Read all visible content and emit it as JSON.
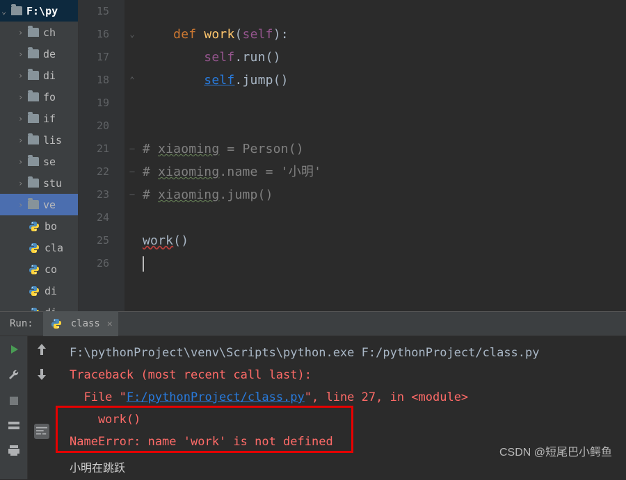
{
  "sidebar": {
    "root": "F:\\py",
    "items": [
      "ch",
      "de",
      "di",
      "fo",
      "if",
      "lis",
      "se",
      "stu",
      "ve",
      "bo",
      "cla",
      "co",
      "di",
      "di"
    ]
  },
  "gutter": {
    "start": 15,
    "end": 26
  },
  "fold_marks": [
    {
      "line": 16,
      "glyph": "⌄"
    },
    {
      "line": 18,
      "glyph": "⌃"
    },
    {
      "line": 21,
      "glyph": "–"
    },
    {
      "line": 22,
      "glyph": "–"
    },
    {
      "line": 23,
      "glyph": "–"
    }
  ],
  "code": {
    "def": "def",
    "work": "work",
    "self_param": "self",
    "colon": ":",
    "self1": "self",
    "run": ".run()",
    "self2": "self",
    "jump": ".jump()",
    "cmt1_hash": "# ",
    "cmt1_name": "xiaoming",
    "cmt1_rest": " = Person()",
    "cmt2_hash": "# ",
    "cmt2_name": "xiaoming",
    "cmt2_rest": ".name = '小明'",
    "cmt3_hash": "# ",
    "cmt3_name": "xiaoming",
    "cmt3_rest": ".jump()",
    "work_call": "work",
    "work_call_paren": "()"
  },
  "run": {
    "label": "Run:",
    "tab": "class",
    "lines": {
      "cmd": "F:\\pythonProject\\venv\\Scripts\\python.exe F:/pythonProject/class.py",
      "tb": "Traceback (most recent call last):",
      "file_pre": "  File \"",
      "file_link": "F:/pythonProject/class.py",
      "file_post": "\", line 27, in <module>",
      "call": "    work()",
      "err": "NameError: name 'work' is not defined"
    }
  },
  "watermark": "CSDN @短尾巴小鳄鱼",
  "extra": "小明在跳跃"
}
